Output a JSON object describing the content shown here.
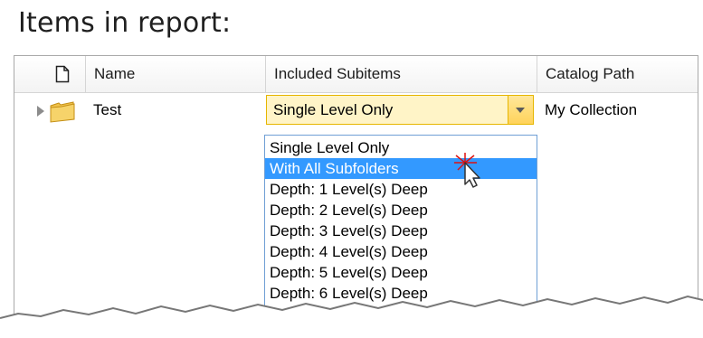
{
  "title": "Items in report:",
  "columns": [
    {
      "label": ""
    },
    {
      "label": "Name"
    },
    {
      "label": "Included Subitems"
    },
    {
      "label": "Catalog Path"
    }
  ],
  "row": {
    "name": "Test",
    "included_subitems": "Single Level Only",
    "catalog_path": "My Collection"
  },
  "dropdown": {
    "options": [
      "Single Level Only",
      "With All Subfolders",
      "Depth: 1 Level(s) Deep",
      "Depth: 2 Level(s) Deep",
      "Depth: 3 Level(s) Deep",
      "Depth: 4 Level(s) Deep",
      "Depth: 5 Level(s) Deep",
      "Depth: 6 Level(s) Deep"
    ],
    "selected_index": 1
  },
  "icons": {
    "header_icon": "document-icon",
    "row_expander": "triangle-right-icon",
    "row_icon": "folder-icon",
    "combo_arrow": "chevron-down-icon",
    "cursor": "mouse-pointer-icon"
  },
  "colors": {
    "selection": "#3399ff",
    "combo_bg": "#fff4c7",
    "combo_border": "#e6b600",
    "dropdown_border": "#6f9fd5"
  }
}
